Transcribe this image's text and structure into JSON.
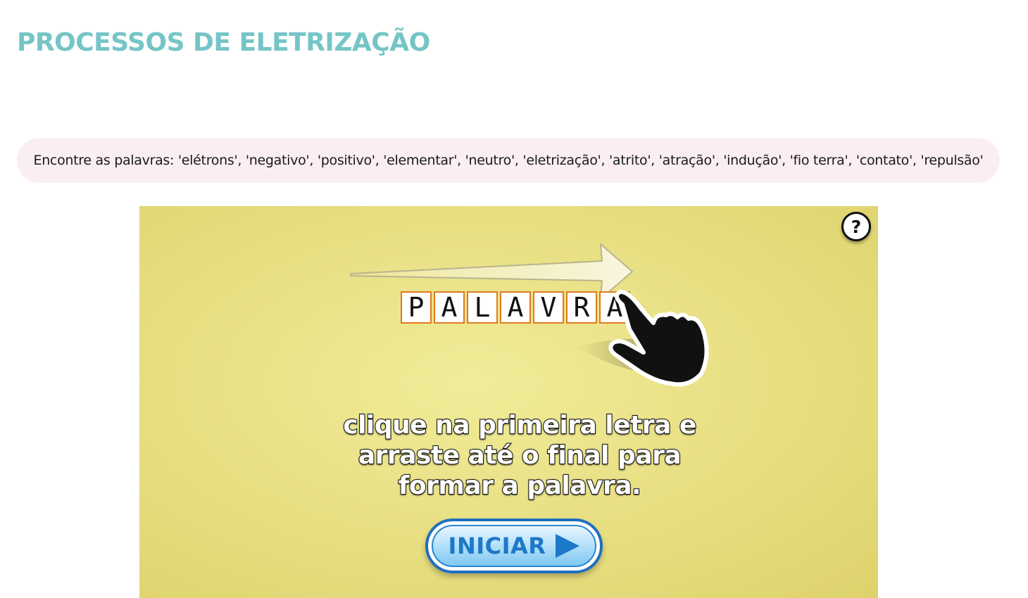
{
  "page": {
    "title": "PROCESSOS DE ELETRIZAÇÃO",
    "instructions": "Encontre as palavras: 'elétrons', 'negativo', 'positivo', 'elementar', 'neutro', 'eletrização', 'atrito', 'atração', 'indução', 'fio terra', 'contato', 'repulsão'"
  },
  "game": {
    "help_label": "?",
    "demo_letters": [
      "P",
      "A",
      "L",
      "A",
      "V",
      "R",
      "A"
    ],
    "instruction_line1": "clique na primeira letra e",
    "instruction_line2": "arraste até o final para",
    "instruction_line3": "formar a palavra.",
    "start_label": "INICIAR",
    "colors": {
      "title": "#76c5c6",
      "instructions_bg": "#fbeef1",
      "game_bg": "#e8df82",
      "letter_border": "#e07a1e",
      "start_button": "#1e78c8"
    },
    "icons": [
      "help-icon",
      "arrow-right-icon",
      "pointing-hand-icon",
      "play-icon"
    ]
  }
}
